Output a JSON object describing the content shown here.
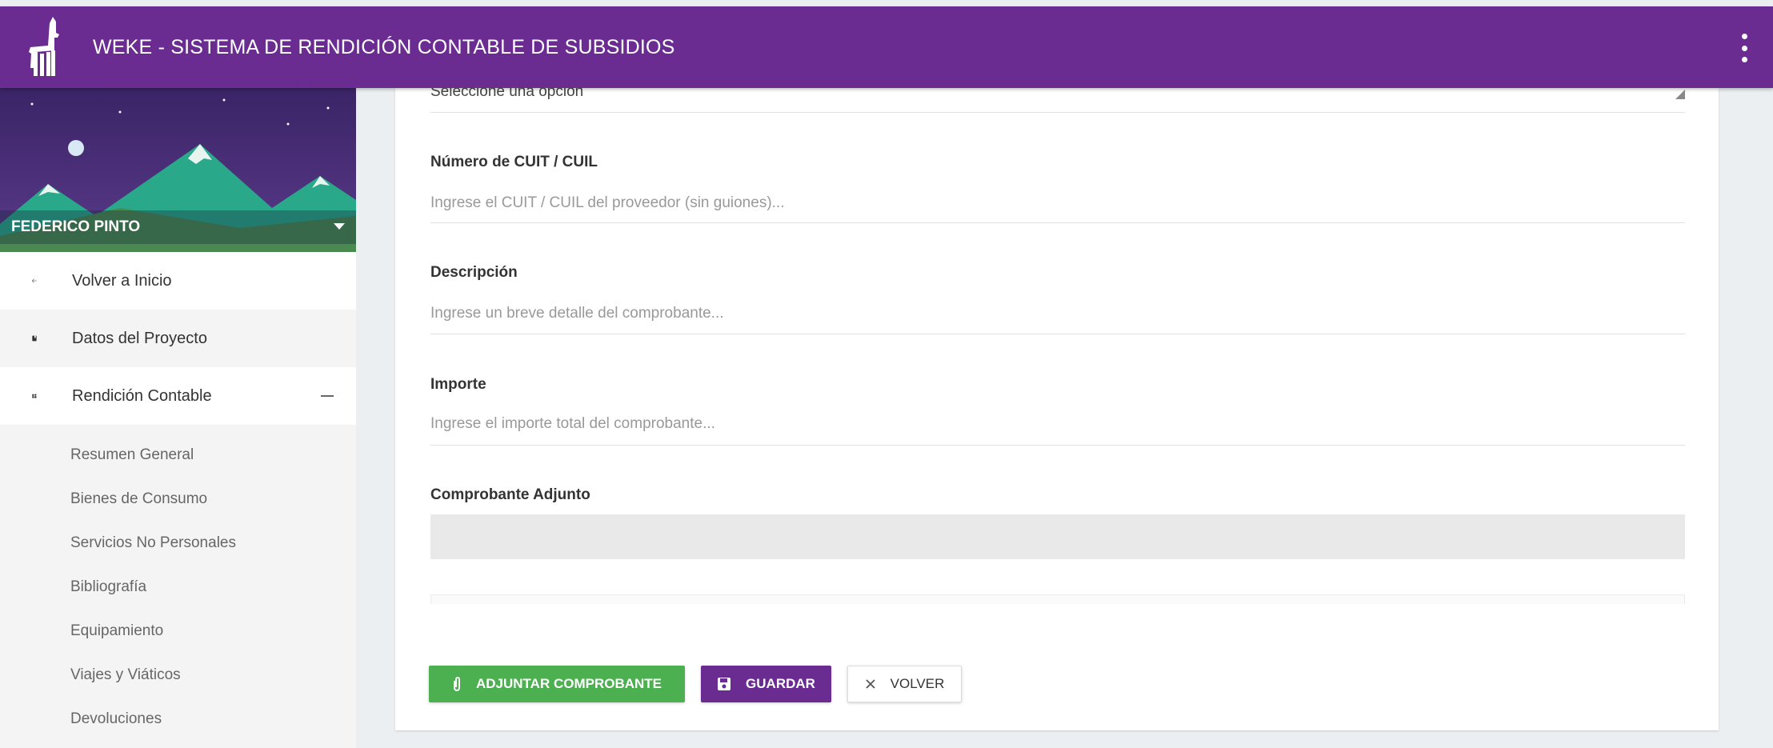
{
  "header": {
    "title": "WEKE - SISTEMA DE RENDICIÓN CONTABLE DE SUBSIDIOS",
    "logo_icon": "llama-icon",
    "menu_icon": "more-vert-icon",
    "color": "#6a2c91"
  },
  "sidebar": {
    "user_name": "FEDERICO PINTO",
    "back_label": "Volver a Inicio",
    "project_label": "Datos del Proyecto",
    "accounting_label": "Rendición Contable",
    "sub_items": [
      "Resumen General",
      "Bienes de Consumo",
      "Servicios No Personales",
      "Bibliografía",
      "Equipamiento",
      "Viajes y Viáticos",
      "Devoluciones"
    ]
  },
  "form": {
    "select_value": "Seleccione una opción",
    "cuit_label": "Número de CUIT / CUIL",
    "cuit_placeholder": "Ingrese el CUIT / CUIL del proveedor (sin guiones)...",
    "description_label": "Descripción",
    "description_placeholder": "Ingrese un breve detalle del comprobante...",
    "amount_label": "Importe",
    "amount_placeholder": "Ingrese el importe total del comprobante...",
    "attachment_label": "Comprobante Adjunto"
  },
  "buttons": {
    "attach_label": "ADJUNTAR COMPROBANTE",
    "save_label": "GUARDAR",
    "back_label": "VOLVER",
    "attach_color": "#4caf50",
    "save_color": "#6a2c91"
  }
}
